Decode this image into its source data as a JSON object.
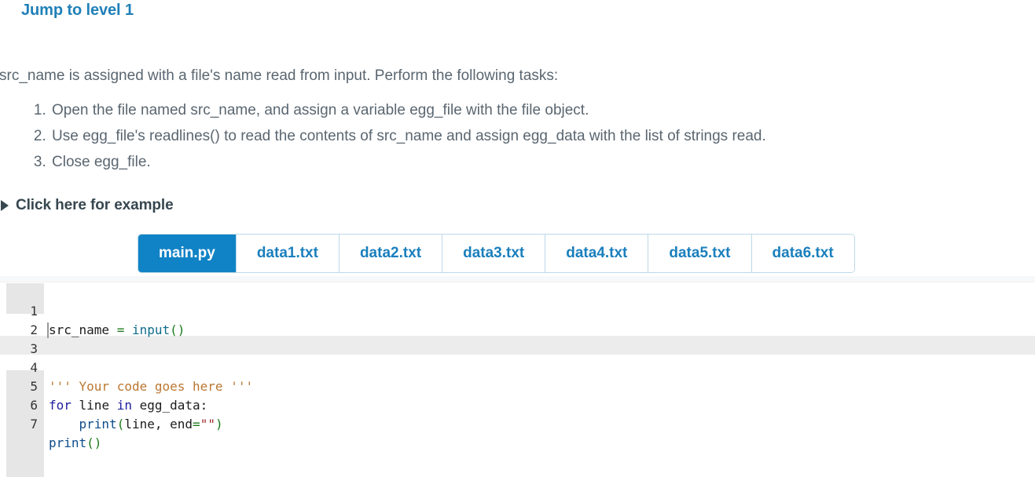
{
  "heading": {
    "text": "Jump to level 1",
    "color": "#2080b8"
  },
  "intro": {
    "text": "src_name is assigned with a file's name read from input. Perform the following tasks:"
  },
  "tasks": [
    "Open the file named src_name, and assign a variable egg_file with the file object.",
    "Use egg_file's readlines() to read the contents of src_name and assign egg_data with the list of strings read.",
    "Close egg_file."
  ],
  "disclosure": {
    "icon": "triangle-right-icon",
    "label": "Click here for example",
    "expanded": false
  },
  "tabs": {
    "active_index": 0,
    "items": [
      {
        "label": "main.py",
        "active": true
      },
      {
        "label": "data1.txt",
        "active": false
      },
      {
        "label": "data2.txt",
        "active": false
      },
      {
        "label": "data3.txt",
        "active": false
      },
      {
        "label": "data4.txt",
        "active": false
      },
      {
        "label": "data5.txt",
        "active": false
      },
      {
        "label": "data6.txt",
        "active": false
      }
    ],
    "active_bg": "#1083c6",
    "inactive_fg": "#1a7fbd",
    "border": "#bdd8e8"
  },
  "editor": {
    "active_file": "main.py",
    "highlighted_line": 3,
    "cursor_line": 3,
    "cursor_column": 1,
    "line_numbers": [
      "1",
      "2",
      "3",
      "4",
      "5",
      "6",
      "7"
    ],
    "lines": [
      {
        "n": "1",
        "text": "src_name = input()"
      },
      {
        "n": "2",
        "text": ""
      },
      {
        "n": "3",
        "text": "''' Your code goes here '''"
      },
      {
        "n": "4",
        "text": ""
      },
      {
        "n": "5",
        "text": "for line in egg_data:"
      },
      {
        "n": "6",
        "text": "    print(line, end=\"\")"
      },
      {
        "n": "7",
        "text": "print()"
      }
    ],
    "tokens": {
      "l1": [
        {
          "t": "src_name ",
          "c": "tok-plain"
        },
        {
          "t": "=",
          "c": "tok-op"
        },
        {
          "t": " ",
          "c": "tok-plain"
        },
        {
          "t": "input",
          "c": "tok-builtin"
        },
        {
          "t": "()",
          "c": "tok-paren"
        }
      ],
      "l3": [
        {
          "t": "''' Your code goes here '''",
          "c": "tok-cmt"
        }
      ],
      "l5": [
        {
          "t": "for",
          "c": "tok-kw"
        },
        {
          "t": " line ",
          "c": "tok-plain"
        },
        {
          "t": "in",
          "c": "tok-kw"
        },
        {
          "t": " egg_data:",
          "c": "tok-plain"
        }
      ],
      "l6": [
        {
          "t": "    ",
          "c": "tok-plain"
        },
        {
          "t": "print",
          "c": "tok-fn"
        },
        {
          "t": "(",
          "c": "tok-paren"
        },
        {
          "t": "line, end",
          "c": "tok-plain"
        },
        {
          "t": "=",
          "c": "tok-op"
        },
        {
          "t": "\"\"",
          "c": "tok-str"
        },
        {
          "t": ")",
          "c": "tok-paren"
        }
      ],
      "l7": [
        {
          "t": "print",
          "c": "tok-fn"
        },
        {
          "t": "()",
          "c": "tok-paren"
        }
      ]
    }
  }
}
